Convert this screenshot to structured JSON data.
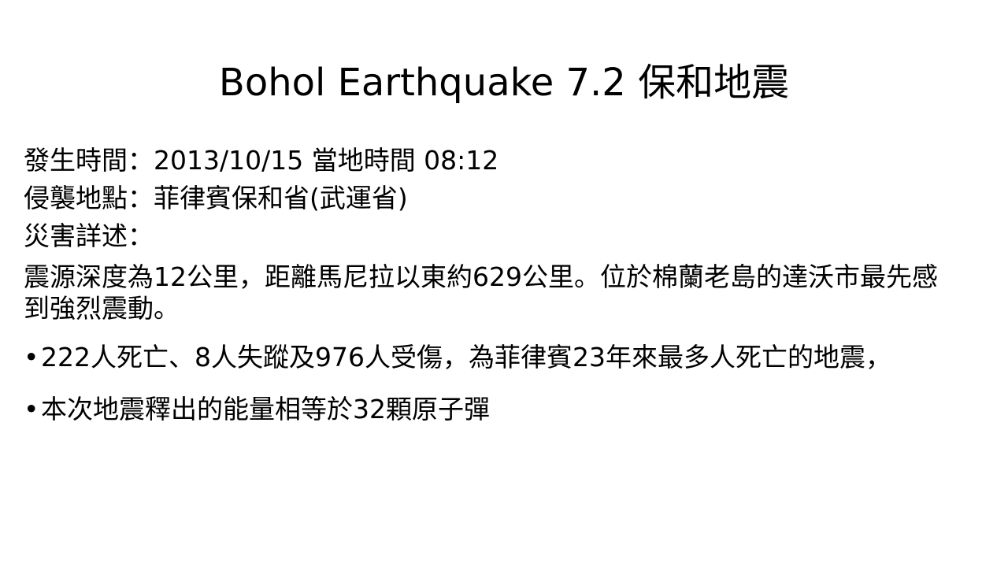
{
  "slide": {
    "title": "Bohol Earthquake  7.2 保和地震",
    "details": [
      "發生時間：2013/10/15  當地時間 08:12",
      "侵襲地點：菲律賓保和省(武運省)",
      "災害詳述："
    ],
    "description": "震源深度為12公里，距離馬尼拉以東約629公里。位於棉蘭老島的達沃市最先感到強烈震動。",
    "bullet_symbol": "•",
    "bullets": [
      "222人死亡、8人失蹤及976人受傷，為菲律賓23年來最多人死亡的地震，",
      "本次地震釋出的能量相等於32顆原子彈"
    ]
  }
}
